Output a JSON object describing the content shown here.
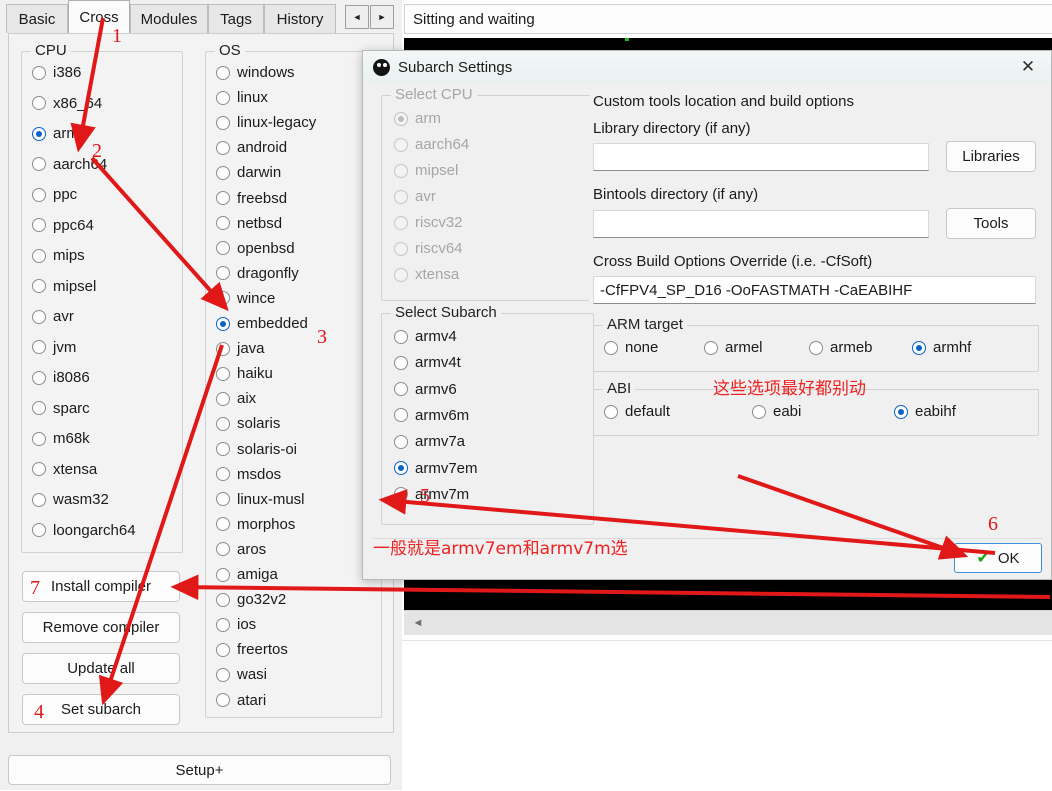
{
  "window": {
    "tabs": [
      {
        "label": "Basic",
        "active": false
      },
      {
        "label": "Cross",
        "active": true
      },
      {
        "label": "Modules",
        "active": false
      },
      {
        "label": "Tags",
        "active": false
      },
      {
        "label": "History",
        "active": false
      }
    ],
    "nav_prev": "◄",
    "nav_next": "►",
    "status_text": "Sitting and waiting",
    "scroll_left_arrow": "◄"
  },
  "cpu_group": {
    "title": "CPU",
    "items": [
      {
        "label": "i386",
        "selected": false
      },
      {
        "label": "x86_64",
        "selected": false
      },
      {
        "label": "arm",
        "selected": true
      },
      {
        "label": "aarch64",
        "selected": false
      },
      {
        "label": "ppc",
        "selected": false
      },
      {
        "label": "ppc64",
        "selected": false
      },
      {
        "label": "mips",
        "selected": false
      },
      {
        "label": "mipsel",
        "selected": false
      },
      {
        "label": "avr",
        "selected": false
      },
      {
        "label": "jvm",
        "selected": false
      },
      {
        "label": "i8086",
        "selected": false
      },
      {
        "label": "sparc",
        "selected": false
      },
      {
        "label": "m68k",
        "selected": false
      },
      {
        "label": "xtensa",
        "selected": false
      },
      {
        "label": "wasm32",
        "selected": false
      },
      {
        "label": "loongarch64",
        "selected": false
      }
    ]
  },
  "os_group": {
    "title": "OS",
    "items": [
      {
        "label": "windows",
        "selected": false
      },
      {
        "label": "linux",
        "selected": false
      },
      {
        "label": "linux-legacy",
        "selected": false
      },
      {
        "label": "android",
        "selected": false
      },
      {
        "label": "darwin",
        "selected": false
      },
      {
        "label": "freebsd",
        "selected": false
      },
      {
        "label": "netbsd",
        "selected": false
      },
      {
        "label": "openbsd",
        "selected": false
      },
      {
        "label": "dragonfly",
        "selected": false
      },
      {
        "label": "wince",
        "selected": false
      },
      {
        "label": "embedded",
        "selected": true
      },
      {
        "label": "java",
        "selected": false
      },
      {
        "label": "haiku",
        "selected": false
      },
      {
        "label": "aix",
        "selected": false
      },
      {
        "label": "solaris",
        "selected": false
      },
      {
        "label": "solaris-oi",
        "selected": false
      },
      {
        "label": "msdos",
        "selected": false
      },
      {
        "label": "linux-musl",
        "selected": false
      },
      {
        "label": "morphos",
        "selected": false
      },
      {
        "label": "aros",
        "selected": false
      },
      {
        "label": "amiga",
        "selected": false
      },
      {
        "label": "go32v2",
        "selected": false
      },
      {
        "label": "ios",
        "selected": false
      },
      {
        "label": "freertos",
        "selected": false
      },
      {
        "label": "wasi",
        "selected": false
      },
      {
        "label": "atari",
        "selected": false
      }
    ]
  },
  "actions": {
    "install_compiler": "Install compiler",
    "remove_compiler": "Remove compiler",
    "update_all": "Update all",
    "set_subarch": "Set subarch",
    "setup_plus": "Setup+"
  },
  "dialog": {
    "title": "Subarch Settings",
    "close_icon": "✕",
    "select_cpu": {
      "title": "Select CPU",
      "disabled": true,
      "items": [
        {
          "label": "arm",
          "selected": true
        },
        {
          "label": "aarch64",
          "selected": false
        },
        {
          "label": "mipsel",
          "selected": false
        },
        {
          "label": "avr",
          "selected": false
        },
        {
          "label": "riscv32",
          "selected": false
        },
        {
          "label": "riscv64",
          "selected": false
        },
        {
          "label": "xtensa",
          "selected": false
        }
      ]
    },
    "select_subarch": {
      "title": "Select Subarch",
      "items": [
        {
          "label": "armv4",
          "selected": false
        },
        {
          "label": "armv4t",
          "selected": false
        },
        {
          "label": "armv6",
          "selected": false
        },
        {
          "label": "armv6m",
          "selected": false
        },
        {
          "label": "armv7a",
          "selected": false
        },
        {
          "label": "armv7em",
          "selected": true
        },
        {
          "label": "armv7m",
          "selected": false
        }
      ]
    },
    "custom_tools": {
      "title": "Custom tools location and build options",
      "library_label": "Library directory (if any)",
      "library_value": "",
      "library_button": "Libraries",
      "bintools_label": "Bintools directory (if any)",
      "bintools_value": "",
      "bintools_button": "Tools",
      "cross_label": "Cross Build Options Override (i.e. -CfSoft)",
      "cross_value": "-CfFPV4_SP_D16 -OoFASTMATH -CaEABIHF"
    },
    "arm_target": {
      "title": "ARM target",
      "items": [
        {
          "label": "none",
          "selected": false
        },
        {
          "label": "armel",
          "selected": false
        },
        {
          "label": "armeb",
          "selected": false
        },
        {
          "label": "armhf",
          "selected": true
        }
      ]
    },
    "abi": {
      "title": "ABI",
      "items": [
        {
          "label": "default",
          "selected": false
        },
        {
          "label": "eabi",
          "selected": false
        },
        {
          "label": "eabihf",
          "selected": true
        }
      ]
    },
    "ok_button": "OK",
    "ok_check": "✔"
  },
  "annotations": {
    "accent_color": "#e01818",
    "numbers": [
      "1",
      "2",
      "3",
      "4",
      "5",
      "6",
      "7"
    ],
    "note_options": "这些选项最好都别动",
    "note_subarch": "一般就是armv7em和armv7m选"
  }
}
